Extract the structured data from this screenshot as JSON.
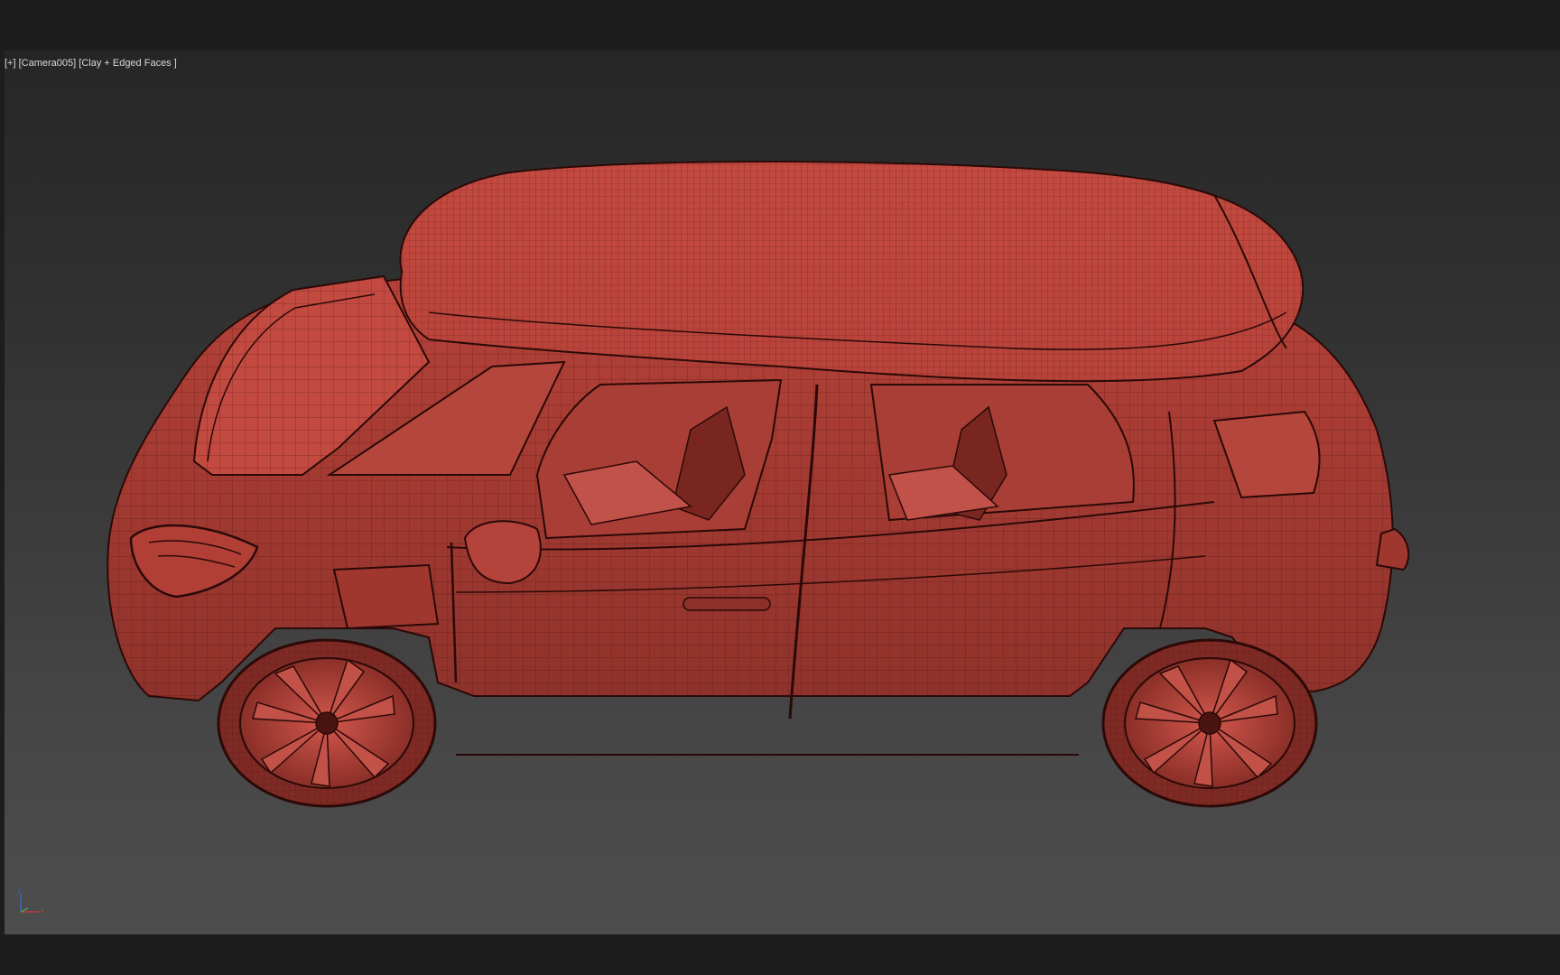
{
  "viewport": {
    "label_plus": "[+]",
    "label_camera": "[Camera005]",
    "label_shading": "[Clay + Edged Faces ]",
    "model_color": "#c1463d",
    "wire_color": "#3a0d0b",
    "background_top": "#262626",
    "background_bottom": "#4d4d4d"
  },
  "axis_gizmo": {
    "z_label": "z",
    "x_label": "x",
    "z_color": "#3b6cd6",
    "x_color": "#d23b3b",
    "y_color": "#3bbf4a"
  }
}
